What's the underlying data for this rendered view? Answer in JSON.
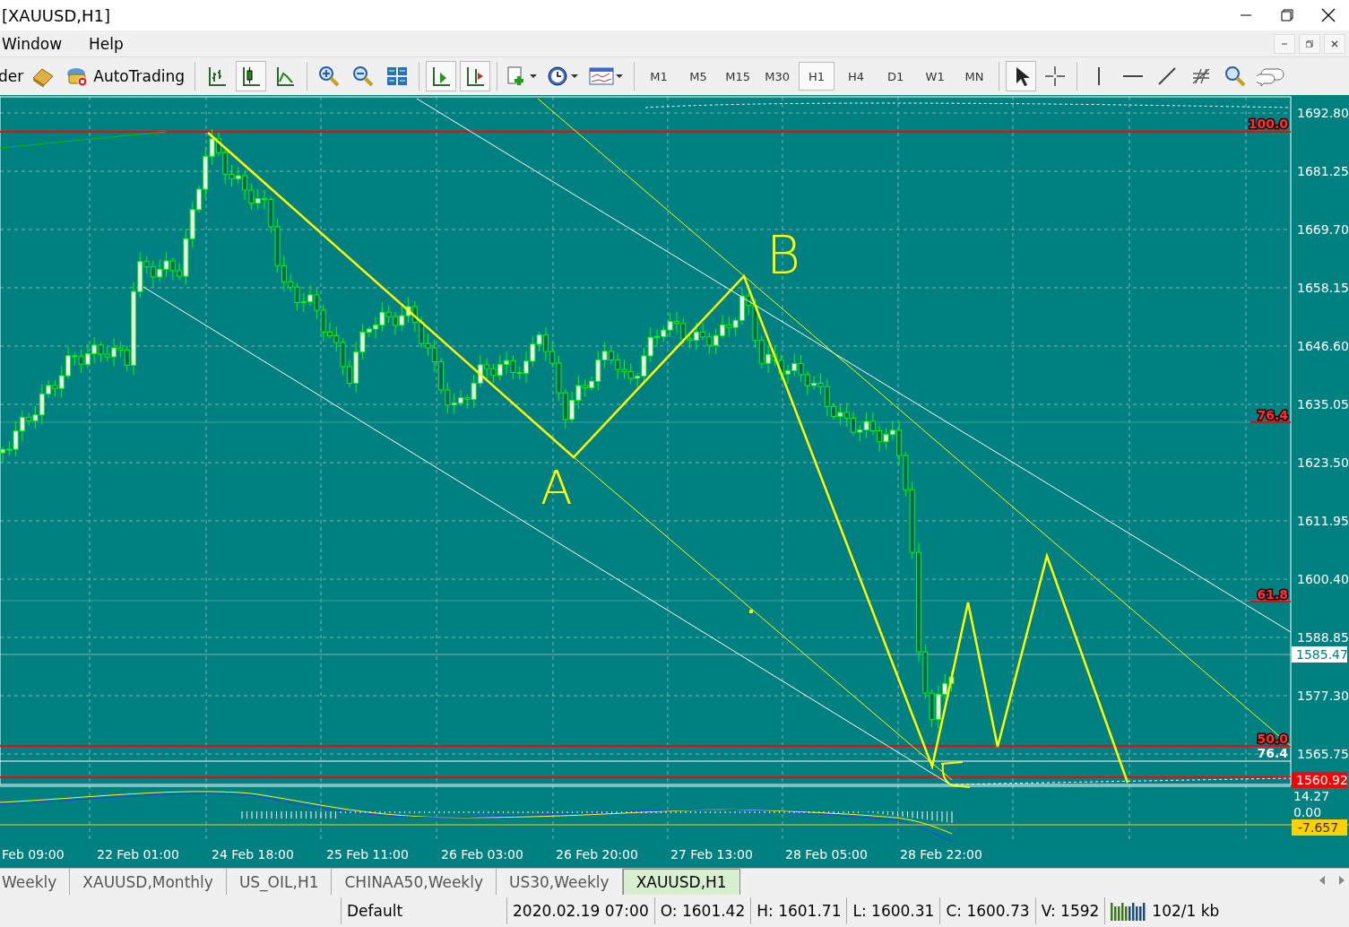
{
  "window": {
    "title": "[XAUUSD,H1]"
  },
  "menu": [
    "Window",
    "Help"
  ],
  "toolbar": {
    "cut_label": "der",
    "autotrading": "AutoTrading",
    "timeframes": [
      {
        "label": "M1",
        "selected": false
      },
      {
        "label": "M5",
        "selected": false
      },
      {
        "label": "M15",
        "selected": false
      },
      {
        "label": "M30",
        "selected": false
      },
      {
        "label": "H1",
        "selected": true
      },
      {
        "label": "H4",
        "selected": false
      },
      {
        "label": "D1",
        "selected": false
      },
      {
        "label": "W1",
        "selected": false
      },
      {
        "label": "MN",
        "selected": false
      }
    ]
  },
  "chart": {
    "price_labels": [
      "1692.80",
      "1681.25",
      "1669.70",
      "1658.15",
      "1646.60",
      "1635.05",
      "1623.50",
      "1611.95",
      "1600.40",
      "1588.85",
      "1577.30",
      "1565.75"
    ],
    "fib_labels": [
      {
        "label": "100.0",
        "kind": "red"
      },
      {
        "label": "76.4",
        "kind": "red"
      },
      {
        "label": "61.8",
        "kind": "red"
      },
      {
        "label": "50.0",
        "kind": "red"
      },
      {
        "label": "76.4",
        "kind": "white"
      }
    ],
    "bid_price": "1585.47",
    "line_price": "1560.92",
    "indicator_labels": [
      "14.27",
      "0.00"
    ],
    "indicator_value": "-7.657",
    "time_labels": [
      "Feb 09:00",
      "22 Feb 01:00",
      "24 Feb 18:00",
      "25 Feb 11:00",
      "26 Feb 03:00",
      "26 Feb 20:00",
      "27 Feb 13:00",
      "28 Feb 05:00",
      "28 Feb 22:00"
    ],
    "handwritten": [
      "A",
      "B"
    ]
  },
  "tabs": [
    {
      "label": "Weekly",
      "selected": false
    },
    {
      "label": "XAUUSD,Monthly",
      "selected": false
    },
    {
      "label": "US_OIL,H1",
      "selected": false
    },
    {
      "label": "CHINAA50,Weekly",
      "selected": false
    },
    {
      "label": "US30,Weekly",
      "selected": false
    },
    {
      "label": "XAUUSD,H1",
      "selected": true
    }
  ],
  "status_bar": {
    "cells": [
      "Default",
      "2020.02.19 07:00",
      "O: 1601.42",
      "H: 1601.71",
      "L: 1600.31",
      "C: 1600.73",
      "V: 1592"
    ],
    "traffic": "102/1 kb"
  }
}
